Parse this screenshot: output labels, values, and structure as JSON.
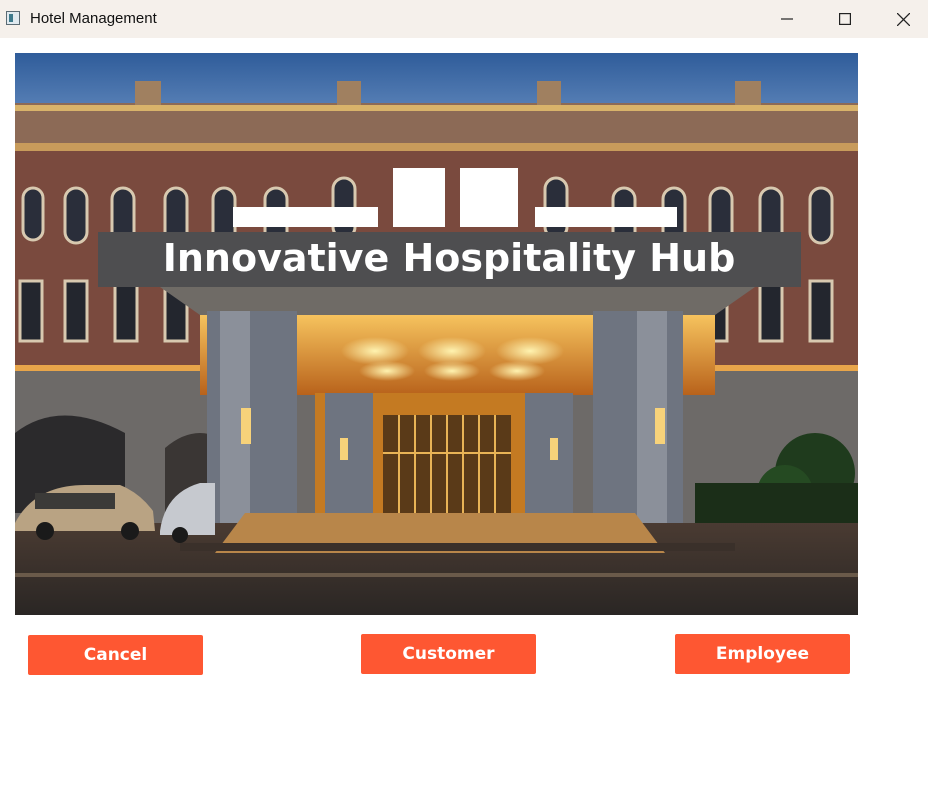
{
  "window": {
    "title": "Hotel Management",
    "icon": "app-window-icon",
    "controls": [
      "minimize-icon",
      "maximize-icon",
      "close-icon"
    ]
  },
  "photo": {
    "banner_text": "Innovative Hospitality Hub"
  },
  "buttons": {
    "cancel": "Cancel",
    "customer": "Customer",
    "employee": "Employee"
  },
  "colors": {
    "button_bg": "#fe5732",
    "titlebar_bg": "#f5f0eb"
  }
}
